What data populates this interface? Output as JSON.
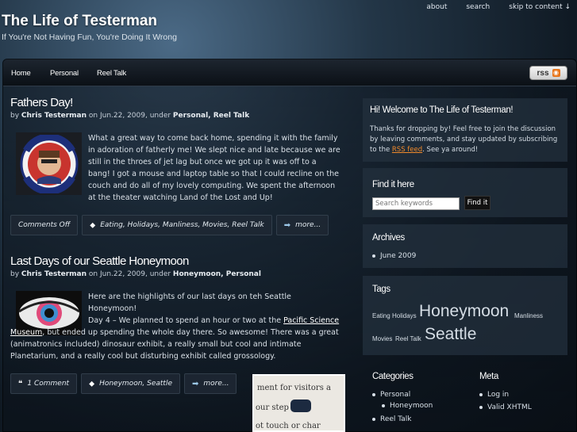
{
  "topnav": {
    "about": "about",
    "search": "search",
    "skip": "skip to content ↓"
  },
  "site": {
    "title": "The Life of Testerman",
    "tagline": "If You're Not Having Fun, You're Doing It Wrong"
  },
  "mainnav": {
    "items": [
      "Home",
      "Personal",
      "Reel Talk"
    ],
    "rss": "rss"
  },
  "posts": [
    {
      "title": "Fathers Day!",
      "meta": {
        "by": "by ",
        "author": "Chris Testerman",
        "on": " on Jun.22, 2009, under ",
        "cats": "Personal, Reel Talk"
      },
      "image_alt": "HAVERCHUCK FOR PRESIDENT",
      "body": "What a great way to come back home, spending it with the family in adoration of fatherly me!  We slept nice and late because we are still in the throes of jet lag but once we got up it was off to a bang!  I got a mouse and laptop table so that I could recline on the couch and do all of my lovely computing.  We spent the afternoon at the theater watching Land of the Lost and Up!",
      "comments": "Comments Off",
      "tags": "Eating, Holidays, Manliness, Movies, Reel Talk",
      "more": "more..."
    },
    {
      "title": "Last Days of our Seattle Honeymoon",
      "meta": {
        "by": "by ",
        "author": "Chris Testerman",
        "on": " on Jun.22, 2009, under ",
        "cats": "Honeymoon, Personal"
      },
      "intro": "Here are the highlights of our last days on teh Seattle Honeymoon!",
      "day_prefix": "Day 4 – We planned to spend an hour or two at the ",
      "link": "Pacific Science Museum",
      "day_rest": ", but ended up spending the whole day there.  So awesome!  There was a great (animatronics included) dinosaur exhibit, a really small but cool and intimate Planetarium, and a really cool but disturbing exhibit called grossology.",
      "comments": "1 Comment",
      "tags": "Honeymoon, Seattle",
      "more": "more...",
      "photo_text": [
        "ment for visitors a",
        "our step",
        "ot touch or char"
      ]
    }
  ],
  "sidebar": {
    "welcome": {
      "title": "Hi! Welcome to The Life of Testerman!",
      "text_a": "Thanks for dropping by! Feel free to join the discussion by leaving comments, and stay updated by subscribing to the ",
      "link": "RSS feed",
      "text_b": ". See ya around!"
    },
    "find": {
      "title": "Find it here",
      "placeholder": "Search keywords",
      "button": "Find it"
    },
    "archives": {
      "title": "Archives",
      "items": [
        "June 2009"
      ]
    },
    "tags": {
      "title": "Tags",
      "items": [
        {
          "label": "Eating",
          "size": "small"
        },
        {
          "label": "Holidays",
          "size": "small"
        },
        {
          "label": "Honeymoon",
          "size": "large"
        },
        {
          "label": "Manliness",
          "size": "small"
        },
        {
          "label": "Movies",
          "size": "small"
        },
        {
          "label": "Reel Talk",
          "size": "small"
        },
        {
          "label": "Seattle",
          "size": "large"
        }
      ]
    },
    "categories": {
      "title": "Categories",
      "items": [
        "Personal",
        "Honeymoon",
        "Reel Talk"
      ]
    },
    "meta": {
      "title": "Meta",
      "items": [
        "Log in",
        "Valid XHTML"
      ]
    }
  },
  "colors": {
    "link_orange": "#f08a2b",
    "title_white": "#ffffff"
  }
}
